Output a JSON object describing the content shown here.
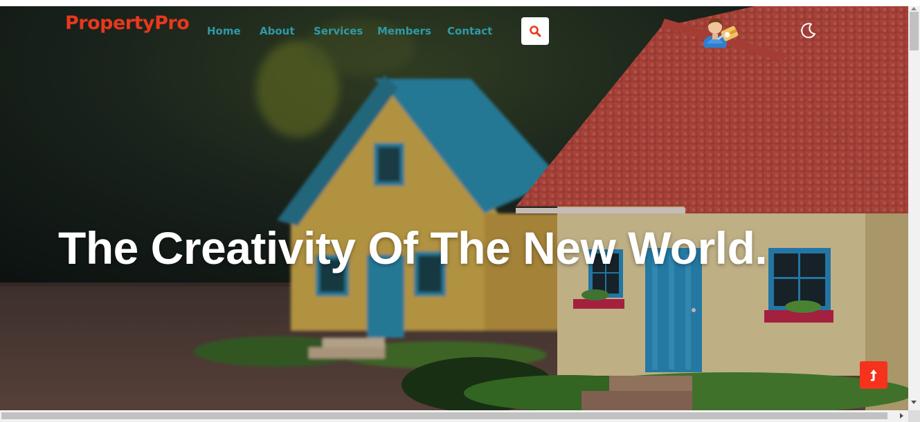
{
  "brand": {
    "name": "PropertyPro",
    "color": "#e8381e"
  },
  "nav": {
    "link_color": "#2f9aa6",
    "links": [
      {
        "label": "Home"
      },
      {
        "label": "About"
      },
      {
        "label": "Services"
      },
      {
        "label": "Members"
      },
      {
        "label": "Contact"
      }
    ]
  },
  "actions": {
    "search_icon": "search-icon",
    "avatar_icon": "user-key-avatar-icon",
    "theme_icon": "moon-icon",
    "scroll_top_icon": "arrow-up-icon"
  },
  "hero": {
    "title": "The Creativity Of The New World.",
    "background": "two-toy-houses-photo"
  },
  "colors": {
    "accent": "#f5321c",
    "title": "#ffffff"
  }
}
